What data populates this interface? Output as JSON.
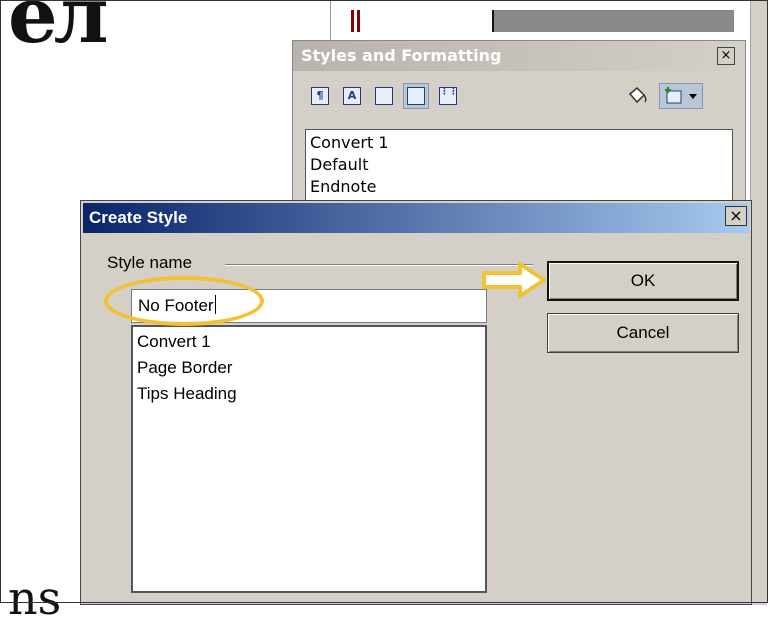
{
  "background": {
    "doc_text_top": "ел",
    "doc_text_bottom": "ns"
  },
  "styles_panel": {
    "title": "Styles and Formatting",
    "close_label": "×",
    "toolbar": [
      {
        "name": "paragraph-styles-icon",
        "glyph": "¶"
      },
      {
        "name": "character-styles-icon",
        "glyph": "A"
      },
      {
        "name": "frame-styles-icon",
        "glyph": ""
      },
      {
        "name": "page-styles-icon",
        "glyph": ""
      },
      {
        "name": "list-styles-icon",
        "glyph": ""
      }
    ],
    "list_items": [
      "Convert 1",
      "Default",
      "Endnote"
    ]
  },
  "dialog": {
    "title": "Create Style",
    "close_label": "×",
    "group_label": "Style name",
    "input_value": "No Footer",
    "existing_styles": [
      "Convert 1",
      "Page Border",
      "Tips Heading"
    ],
    "ok_label": "OK",
    "cancel_label": "Cancel"
  },
  "colors": {
    "highlight": "#f2c232",
    "title_bar_start": "#0a246a",
    "title_bar_end": "#a6caf0"
  }
}
